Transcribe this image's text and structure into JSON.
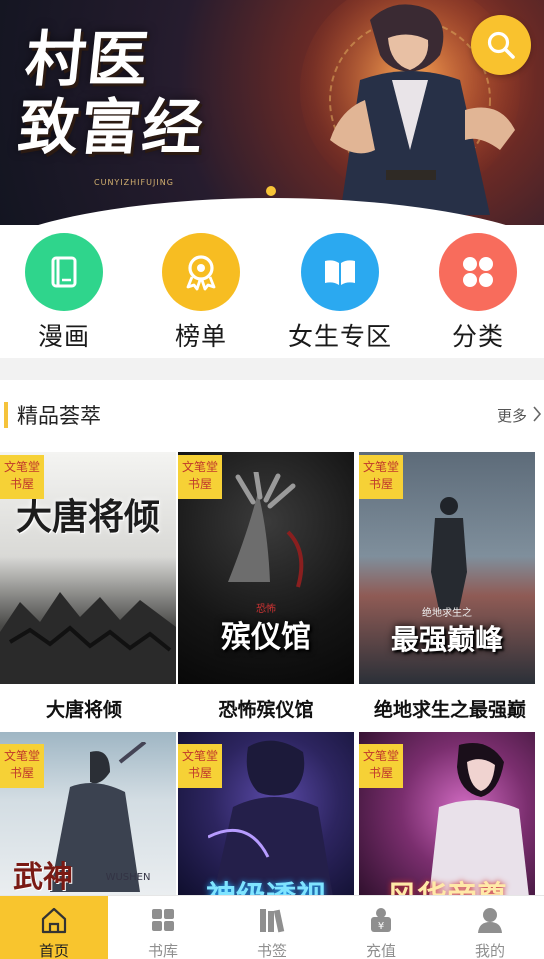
{
  "banner": {
    "title_line1": "村医",
    "title_line2": "致富经",
    "subtitle": "CUNYIZHIFUJING"
  },
  "search": {
    "icon": "search-icon"
  },
  "categories": [
    {
      "label": "漫画",
      "icon": "book-icon",
      "color": "#2fd58c"
    },
    {
      "label": "榜单",
      "icon": "medal-icon",
      "color": "#f7bd22"
    },
    {
      "label": "女生专区",
      "icon": "open-book-icon",
      "color": "#2ba9f0"
    },
    {
      "label": "分类",
      "icon": "grid-icon",
      "color": "#f86c5c"
    }
  ],
  "section": {
    "title": "精品荟萃",
    "more": "更多"
  },
  "badge_text": "文笔堂书屋",
  "books": [
    {
      "name": "大唐将倾",
      "cover_title": "大唐将倾"
    },
    {
      "name": "恐怖殡仪馆",
      "cover_title": "殡仪馆",
      "cover_tag": "恐怖"
    },
    {
      "name": "绝地求生之最强巅",
      "cover_title": "最强巅峰",
      "cover_tag": "绝地求生之"
    },
    {
      "name": "",
      "cover_title": "武神",
      "cover_sub": "WUSHEN"
    },
    {
      "name": "",
      "cover_title": "神级透视"
    },
    {
      "name": "",
      "cover_title": "风华帝尊"
    }
  ],
  "tabs": [
    {
      "label": "首页",
      "icon": "home-icon",
      "active": true
    },
    {
      "label": "书库",
      "icon": "grid-icon"
    },
    {
      "label": "书签",
      "icon": "bookshelf-icon"
    },
    {
      "label": "充值",
      "icon": "coin-icon"
    },
    {
      "label": "我的",
      "icon": "user-icon"
    }
  ],
  "accent": "#f8c52e"
}
